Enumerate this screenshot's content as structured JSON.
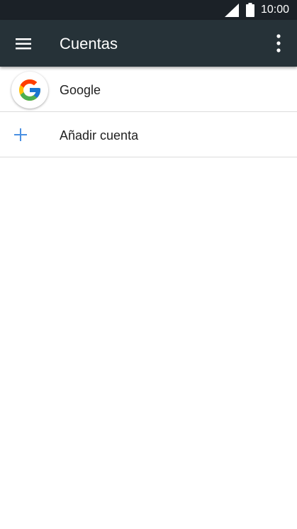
{
  "status_bar": {
    "time": "10:00",
    "icons": [
      "signal-icon",
      "battery-icon"
    ]
  },
  "toolbar": {
    "menu_icon": "hamburger-menu-icon",
    "title": "Cuentas",
    "overflow_icon": "more-vert-icon",
    "background": "#263238"
  },
  "accounts": {
    "items": [
      {
        "label": "Google",
        "icon": "google-logo-icon"
      },
      {
        "label": "Añadir cuenta",
        "icon": "add-icon",
        "icon_color": "#4a90e2"
      }
    ]
  }
}
